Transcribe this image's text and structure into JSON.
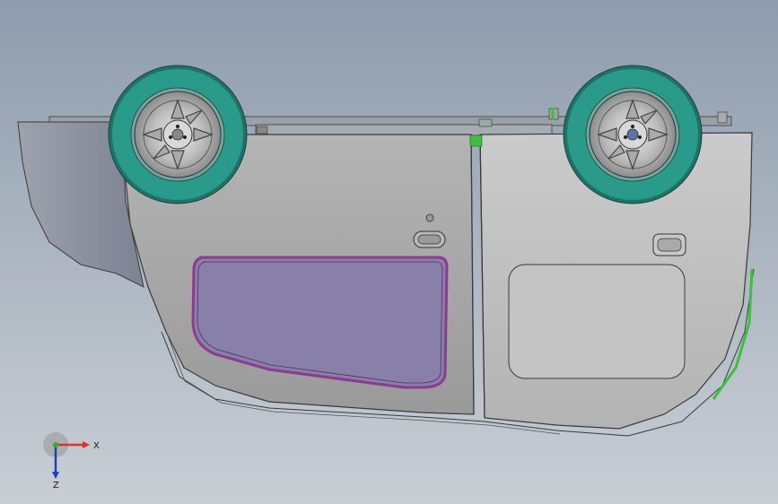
{
  "colors": {
    "background_top": "#8e9cad",
    "background_bottom": "#c9ced5",
    "body_panel": "#a3a3a3",
    "body_panel_light": "#c2c2c2",
    "fender_shadow": "#8a8e9c",
    "window_fill": "#8880aa",
    "window_outline": "#8a3d8f",
    "tire": "#2a9a8a",
    "tire_dark": "#1d7466",
    "rim": "#c8c8c8",
    "accent_green": "#3fbf3f",
    "edge_line": "#3a3a3a"
  },
  "triad": {
    "x_label": "X",
    "z_label": "Z",
    "x_color": "#e03030",
    "y_color": "#30b030",
    "z_color": "#2040c0"
  },
  "model": {
    "wheels": [
      "front-wheel",
      "rear-wheel"
    ],
    "doors": [
      "front-door",
      "rear-door"
    ]
  }
}
